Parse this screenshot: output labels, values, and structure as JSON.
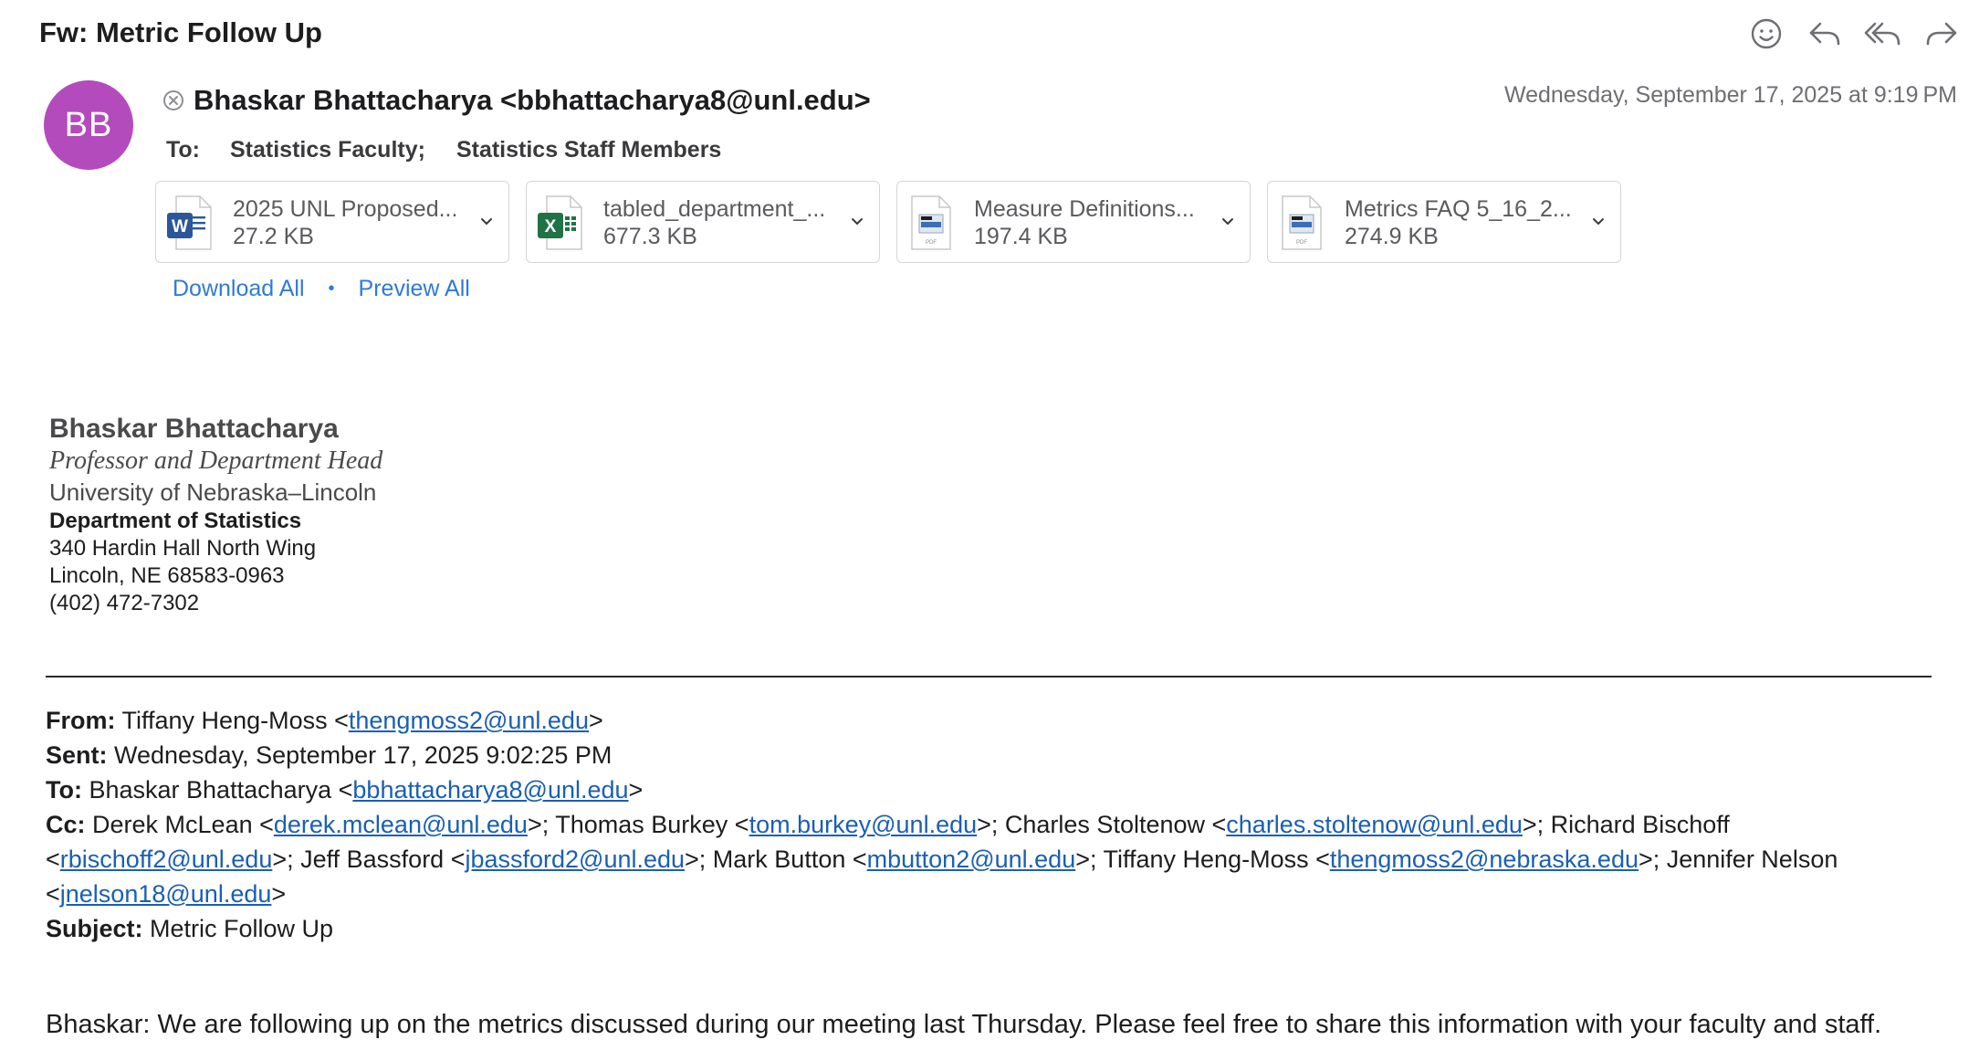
{
  "message": {
    "subject": "Fw: Metric Follow Up",
    "sender": "Bhaskar Bhattacharya <bbhattacharya8@unl.edu>",
    "avatar_initials": "BB",
    "avatar_color": "#b34bbc",
    "date": "Wednesday, September 17, 2025 at 9:19 PM",
    "to_label": "To:",
    "recipients": [
      "Statistics Faculty;",
      "Statistics Staff Members"
    ]
  },
  "toolbar": {
    "icons": [
      "emoji-reaction-icon",
      "reply-icon",
      "reply-all-icon",
      "forward-icon"
    ]
  },
  "attachments": [
    {
      "name": "2025 UNL Proposed...",
      "size": "27.2 KB",
      "type": "word-doc-icon"
    },
    {
      "name": "tabled_department_...",
      "size": "677.3 KB",
      "type": "excel-sheet-icon"
    },
    {
      "name": "Measure Definitions...",
      "size": "197.4 KB",
      "type": "pdf-file-icon"
    },
    {
      "name": "Metrics FAQ 5_16_2...",
      "size": "274.9 KB",
      "type": "pdf-file-icon"
    }
  ],
  "attachment_actions": {
    "download_all": "Download All",
    "separator": "•",
    "preview_all": "Preview All"
  },
  "signature": {
    "name": "Bhaskar Bhattacharya",
    "title": "Professor and Department Head",
    "university": "University of Nebraska–Lincoln",
    "department": "Department of Statistics",
    "address1": "340 Hardin Hall North Wing",
    "address2": "Lincoln, NE 68583-0963",
    "phone": "(402) 472-7302"
  },
  "forwarded": {
    "from_label": "From:",
    "from_name": " Tiffany Heng-Moss <",
    "from_email": "thengmoss2@unl.edu",
    "sent_label": "Sent:",
    "sent_value": " Wednesday, September 17, 2025 9:02:25 PM",
    "to_label": "To:",
    "to_name": " Bhaskar Bhattacharya <",
    "to_email": "bbhattacharya8@unl.edu",
    "cc_label": "Cc:",
    "cc": [
      {
        "prefix": " Derek McLean <",
        "email": "derek.mclean@unl.edu"
      },
      {
        "prefix": ">; Thomas Burkey <",
        "email": "tom.burkey@unl.edu"
      },
      {
        "prefix": ">; Charles Stoltenow <",
        "email": "charles.stoltenow@unl.edu"
      },
      {
        "prefix": ">; Richard Bischoff <",
        "email": "rbischoff2@unl.edu"
      },
      {
        "prefix": ">; Jeff Bassford <",
        "email": "jbassford2@unl.edu"
      },
      {
        "prefix": ">; Mark Button <",
        "email": "mbutton2@unl.edu"
      },
      {
        "prefix": ">; Tiffany Heng-Moss <",
        "email": "thengmoss2@nebraska.edu"
      },
      {
        "prefix": ">; Jennifer Nelson <",
        "email": "jnelson18@unl.edu"
      }
    ],
    "close_bracket": ">",
    "subject_label": "Subject:",
    "subject_value": " Metric Follow Up"
  },
  "body": {
    "first_line": "Bhaskar:  We are following up on the metrics discussed during our meeting last Thursday. Please feel free to share this information with your faculty and staff."
  }
}
